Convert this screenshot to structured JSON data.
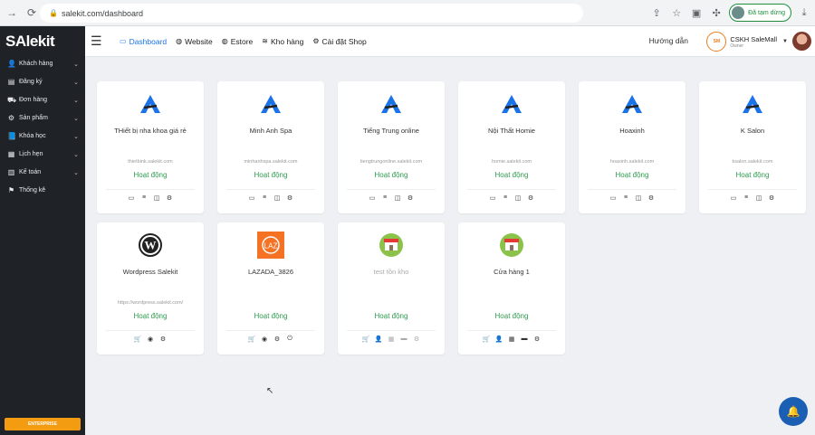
{
  "browser": {
    "url": "salekit.com/dashboard",
    "profile_label": "Đã tạm dừng"
  },
  "sidebar": {
    "logo": "SAlekit",
    "items": [
      {
        "label": "Khách hàng",
        "icon": "person-icon",
        "has_chevron": true
      },
      {
        "label": "Đăng ký",
        "icon": "id-card-icon",
        "has_chevron": true
      },
      {
        "label": "Đơn hàng",
        "icon": "truck-icon",
        "has_chevron": true
      },
      {
        "label": "Sản phẩm",
        "icon": "product-icon",
        "has_chevron": true
      },
      {
        "label": "Khóa học",
        "icon": "book-icon",
        "has_chevron": true
      },
      {
        "label": "Lịch hẹn",
        "icon": "calendar-icon",
        "has_chevron": true
      },
      {
        "label": "Kế toán",
        "icon": "calculator-icon",
        "has_chevron": true
      },
      {
        "label": "Thống kê",
        "icon": "flag-icon",
        "has_chevron": false
      }
    ],
    "enterprise_label": "ENTERPRISE"
  },
  "topnav": {
    "tabs": [
      {
        "label": "Dashboard",
        "icon": "monitor-icon",
        "active": true
      },
      {
        "label": "Website",
        "icon": "globe-icon",
        "active": false
      },
      {
        "label": "Estore",
        "icon": "globe-icon",
        "active": false
      },
      {
        "label": "Kho hàng",
        "icon": "layers-icon",
        "active": false
      },
      {
        "label": "Cài đặt Shop",
        "icon": "gear-icon",
        "active": false
      }
    ],
    "guide_label": "Hướng dẫn",
    "account": {
      "name": "CSKH SaleMall",
      "role": "Owner"
    }
  },
  "cards": [
    {
      "name": "THiết bị nha khoa giá rẻ",
      "url": "thietbink.salekit.com",
      "status": "Hoạt động",
      "logo": "salekit-a-logo",
      "icons": [
        "monitor-icon",
        "list-icon",
        "columns-icon",
        "gear-icon"
      ]
    },
    {
      "name": "Minh Anh Spa",
      "url": "minhanhspa.salekit.com",
      "status": "Hoạt động",
      "logo": "salekit-a-logo",
      "icons": [
        "monitor-icon",
        "list-icon",
        "columns-icon",
        "gear-icon"
      ]
    },
    {
      "name": "Tiếng Trung online",
      "url": "tiengtrungonline.salekit.com",
      "status": "Hoạt động",
      "logo": "salekit-a-logo",
      "icons": [
        "monitor-icon",
        "list-icon",
        "columns-icon",
        "gear-icon"
      ]
    },
    {
      "name": "Nội Thất Homie",
      "url": "homie.salekit.com",
      "status": "Hoạt động",
      "logo": "salekit-a-logo",
      "icons": [
        "monitor-icon",
        "list-icon",
        "columns-icon",
        "gear-icon"
      ]
    },
    {
      "name": "Hoaxinh",
      "url": "hoaxinh.salekit.com",
      "status": "Hoạt động",
      "logo": "salekit-a-logo",
      "icons": [
        "monitor-icon",
        "list-icon",
        "columns-icon",
        "gear-icon"
      ]
    },
    {
      "name": "K Salon",
      "url": "ksalon.salekit.com",
      "status": "Hoạt động",
      "logo": "salekit-a-logo",
      "icons": [
        "monitor-icon",
        "list-icon",
        "columns-icon",
        "gear-icon"
      ]
    },
    {
      "name": "Wordpress Salekit",
      "url": "https://wordpress.salekit.com/",
      "status": "Hoạt động",
      "logo": "wordpress-logo",
      "icons": [
        "cart-icon",
        "compass-icon",
        "gear-icon"
      ]
    },
    {
      "name": "LAZADA_3826",
      "url": "",
      "status": "Hoạt động",
      "logo": "lazada-logo",
      "icons": [
        "cart-icon",
        "compass-icon",
        "gear-icon",
        "power-icon"
      ]
    },
    {
      "name": "test tồn kho",
      "url": "",
      "status": "Hoạt động",
      "logo": "store-logo",
      "icons": [
        "cart-icon",
        "user-icon",
        "calendar-icon",
        "card-icon",
        "gear-icon"
      ],
      "muted": true
    },
    {
      "name": "Cửa hàng 1",
      "url": "",
      "status": "Hoạt động",
      "logo": "store-logo",
      "icons": [
        "cart-icon",
        "user-icon",
        "calendar-icon",
        "card-icon",
        "gear-icon"
      ]
    }
  ]
}
